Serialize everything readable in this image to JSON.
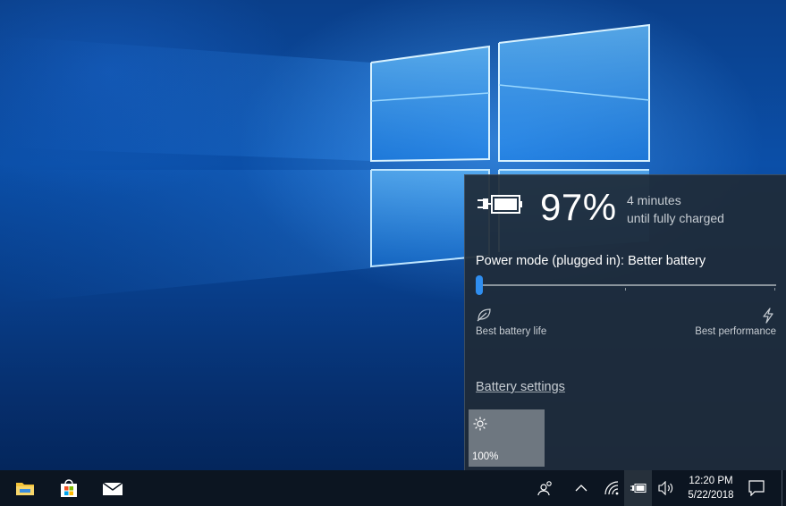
{
  "battery": {
    "percent": "97%",
    "time_line1": "4 minutes",
    "time_line2": "until fully charged",
    "power_mode": "Power mode (plugged in): Better battery",
    "slider_position": 0,
    "left_label": "Best battery life",
    "right_label": "Best performance",
    "settings_link": "Battery settings",
    "brightness": "100%"
  },
  "taskbar": {
    "pinned": [
      {
        "name": "file-explorer-icon"
      },
      {
        "name": "store-icon"
      },
      {
        "name": "mail-icon"
      }
    ],
    "tray": [
      "people-icon",
      "chevron-up-icon",
      "wifi-icon",
      "battery-icon",
      "volume-icon"
    ],
    "time": "12:20 PM",
    "date": "5/22/2018",
    "notification_icon": "action-center-icon"
  },
  "colors": {
    "accent": "#2f8ef0",
    "flyout_bg": "#1f2b38",
    "taskbar_bg": "#0c1521",
    "desktop_blue": "#0b4fa8"
  }
}
